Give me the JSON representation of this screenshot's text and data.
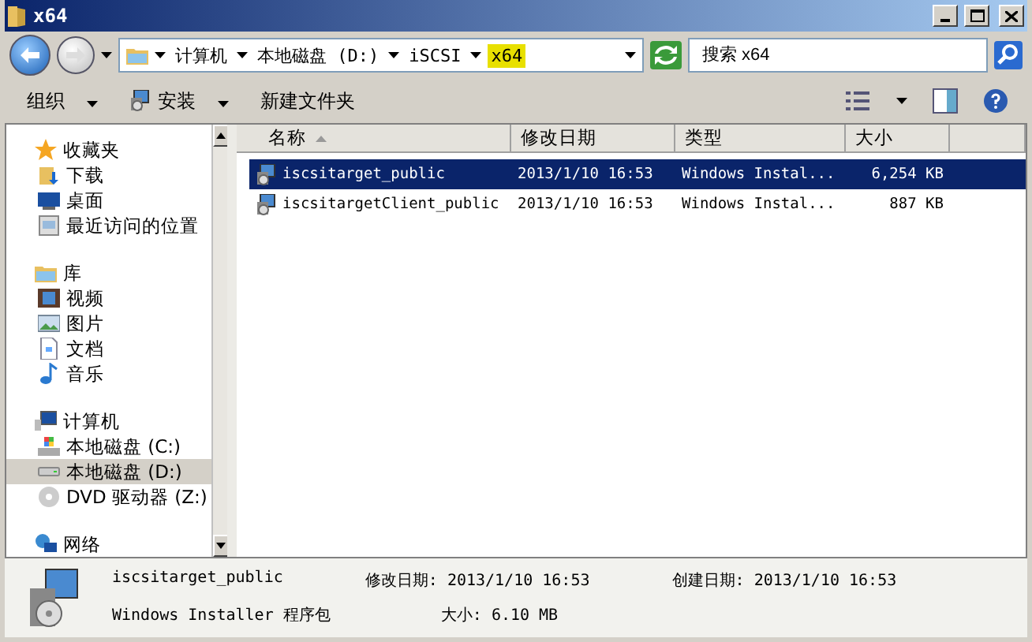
{
  "window": {
    "title": "x64"
  },
  "address": {
    "crumbs": [
      {
        "label": "计算机",
        "selected": false
      },
      {
        "label": "本地磁盘 (D:)",
        "selected": false
      },
      {
        "label": "iSCSI",
        "selected": false
      },
      {
        "label": "x64",
        "selected": true
      }
    ]
  },
  "search": {
    "placeholder": "搜索 x64"
  },
  "toolbar": [
    {
      "label": "组织",
      "kind": "menu"
    },
    {
      "label": "安装",
      "kind": "install"
    },
    {
      "label": "新建文件夹",
      "kind": "plain"
    }
  ],
  "sidebar": {
    "groups": [
      {
        "label": "收藏夹",
        "kind": "star",
        "selected": false,
        "children": [
          {
            "label": "下载",
            "kind": "download",
            "selected": false
          },
          {
            "label": "桌面",
            "kind": "desktop",
            "selected": false
          },
          {
            "label": "最近访问的位置",
            "kind": "recent",
            "selected": false
          }
        ]
      },
      {
        "label": "库",
        "kind": "library",
        "selected": false,
        "children": [
          {
            "label": "视频",
            "kind": "video",
            "selected": false
          },
          {
            "label": "图片",
            "kind": "image",
            "selected": false
          },
          {
            "label": "文档",
            "kind": "document",
            "selected": false
          },
          {
            "label": "音乐",
            "kind": "music",
            "selected": false
          }
        ]
      },
      {
        "label": "计算机",
        "kind": "computer",
        "selected": false,
        "children": [
          {
            "label": "本地磁盘 (C:)",
            "kind": "system-drive",
            "selected": false
          },
          {
            "label": "本地磁盘 (D:)",
            "kind": "drive",
            "selected": true
          },
          {
            "label": "DVD 驱动器 (Z:)",
            "kind": "dvd",
            "selected": false
          }
        ]
      },
      {
        "label": "网络",
        "kind": "network",
        "selected": false
      }
    ]
  },
  "table": {
    "columns": [
      "名称",
      "修改日期",
      "类型",
      "大小"
    ],
    "rows": [
      {
        "name": "iscsitarget_public",
        "modified": "2013/1/10 16:53",
        "type": "Windows Instal...",
        "size": "6,254 KB",
        "selected": true
      },
      {
        "name": "iscsitargetClient_public",
        "modified": "2013/1/10 16:53",
        "type": "Windows Instal...",
        "size": "887 KB",
        "selected": false
      }
    ]
  },
  "details": {
    "name": "iscsitarget_public",
    "type": "Windows Installer 程序包",
    "fields": [
      {
        "label": "修改日期:",
        "value": "2013/1/10 16:53"
      },
      {
        "label": "创建日期:",
        "value": "2013/1/10 16:53"
      },
      {
        "label": "大小:",
        "value": "6.10 MB"
      }
    ]
  }
}
